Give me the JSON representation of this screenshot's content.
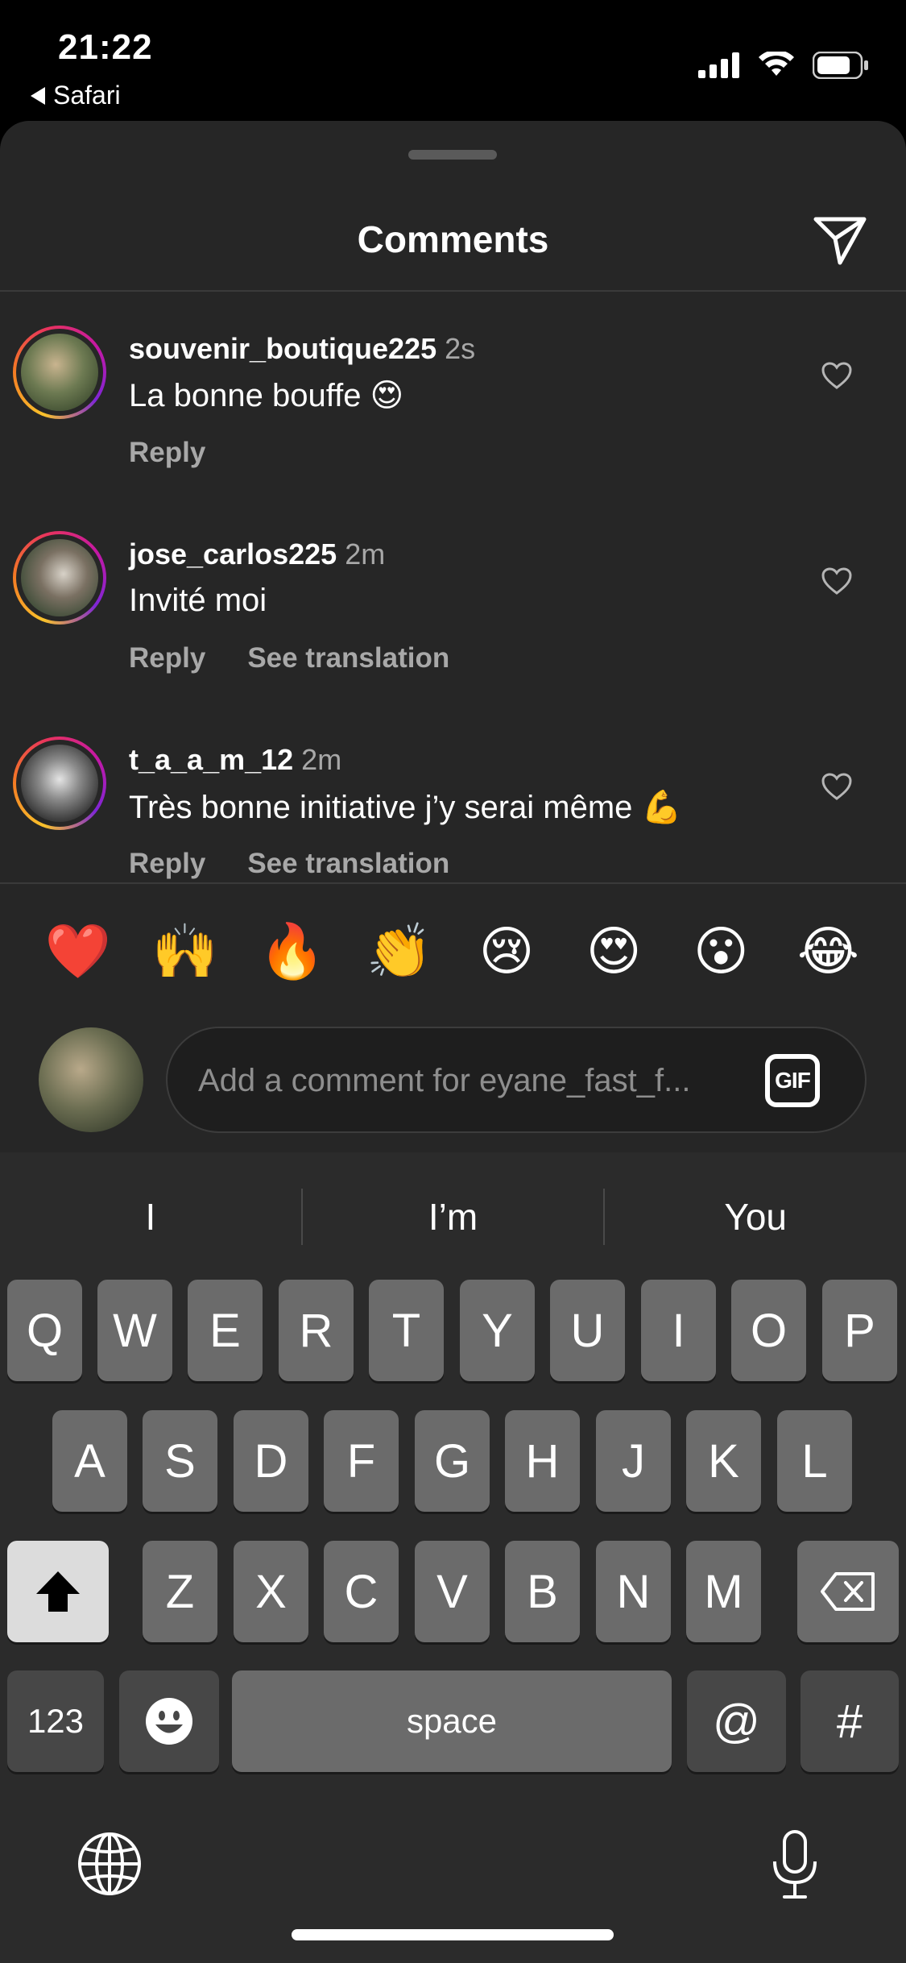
{
  "status_bar": {
    "time": "21:22",
    "back_app": "Safari"
  },
  "sheet": {
    "title": "Comments"
  },
  "comments": [
    {
      "username": "souvenir_boutique225",
      "time": "2s",
      "text": "La bonne bouffe 😍",
      "actions": [
        "Reply"
      ]
    },
    {
      "username": "jose_carlos225",
      "time": "2m",
      "text": "Invité moi",
      "actions": [
        "Reply",
        "See translation"
      ]
    },
    {
      "username": "t_a_a_m_12",
      "time": "2m",
      "text": "Très bonne initiative j’y serai même 💪",
      "actions": [
        "Reply",
        "See translation"
      ]
    }
  ],
  "quick_reactions": [
    "❤️",
    "🙌",
    "🔥",
    "👏",
    "😢",
    "😍",
    "😮",
    "😂"
  ],
  "composer": {
    "placeholder": "Add a comment for eyane_fast_f...",
    "gif_label": "GIF"
  },
  "keyboard": {
    "suggestions": [
      "I",
      "I’m",
      "You"
    ],
    "row1": [
      "Q",
      "W",
      "E",
      "R",
      "T",
      "Y",
      "U",
      "I",
      "O",
      "P"
    ],
    "row2": [
      "A",
      "S",
      "D",
      "F",
      "G",
      "H",
      "J",
      "K",
      "L"
    ],
    "row3": [
      "Z",
      "X",
      "C",
      "V",
      "B",
      "N",
      "M"
    ],
    "numbers_label": "123",
    "space_label": "space",
    "at_label": "@",
    "hash_label": "#"
  },
  "colors": {
    "sheet_bg": "#262626",
    "keyboard_bg": "#2b2b2b",
    "key_bg": "#6b6b6b",
    "muted_text": "#a8a8a8"
  }
}
